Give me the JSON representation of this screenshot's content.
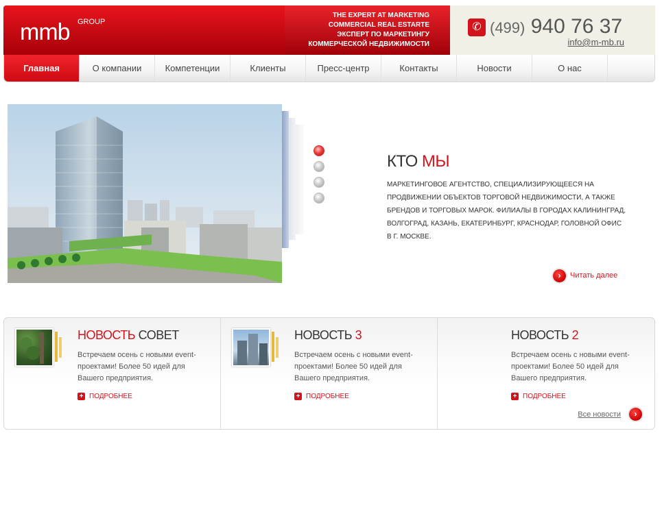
{
  "header": {
    "logo": "mmb",
    "logo_suffix": "GROUP",
    "tagline": [
      "THE EXPERT AT MARKETING",
      "COMMERCIAL REAL ESTARTE",
      "ЭКСПЕРТ ПО МАРКЕТИНГУ",
      "КОММЕРЧЕСКОЙ НЕДВИЖИМОСТИ"
    ],
    "phone_code": "(499)",
    "phone_number": "940 76 37",
    "email": "info@m-mb.ru"
  },
  "nav": {
    "items": [
      {
        "label": "Главная",
        "active": true
      },
      {
        "label": "О компании"
      },
      {
        "label": "Компетенции"
      },
      {
        "label": "Клиенты"
      },
      {
        "label": "Пресс-центр"
      },
      {
        "label": "Контакты"
      },
      {
        "label": "Новости"
      },
      {
        "label": "О нас"
      }
    ]
  },
  "hero": {
    "slides_count": 4,
    "active_slide": 1,
    "title_plain": "КТО",
    "title_accent": "МЫ",
    "text": "Маркетинговое агентство, специализирующееся на продвижении объектов торговой недвижимости, а также брендов и торговых марок. Филиалы в городах Калининград, Волгоград, Казань, Екатеринбург, Краснодар, головной офис в г. Москве.",
    "read_more": "Читать далее"
  },
  "news": [
    {
      "title_plain_before": "",
      "title_accent": "НОВОСТЬ",
      "title_plain_after": " СОВЕТ",
      "body": "Встречаем осень с новыми event-проектами! Более 50 идей для Вашего предприятия.",
      "more": "ПОДРОБНЕЕ",
      "thumb": "forest"
    },
    {
      "title_plain_before": "НОВОСТЬ ",
      "title_accent": "3",
      "title_plain_after": "",
      "body": "Встречаем осень с новыми event-проектами! Более 50 идей для Вашего предприятия.",
      "more": "ПОДРОБНЕЕ",
      "thumb": "buildings"
    },
    {
      "title_plain_before": "НОВОСТЬ ",
      "title_accent": "2",
      "title_plain_after": "",
      "body": "Встречаем осень с новыми event-проектами! Более 50 идей для Вашего предприятия.",
      "more": "ПОДРОБНЕЕ",
      "thumb": "none"
    }
  ],
  "all_news": "Все новости",
  "colors": {
    "brand_red": "#d4121b",
    "contact_bg": "#f1f0e6"
  }
}
